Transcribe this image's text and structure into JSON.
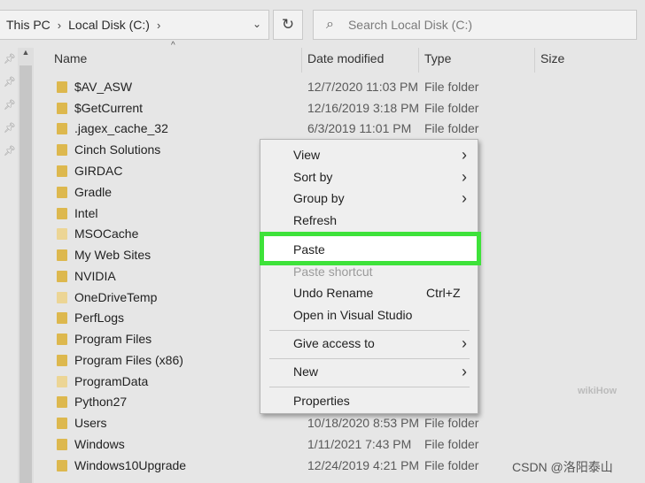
{
  "address": {
    "crumb1": "This PC",
    "crumb2": "Local Disk (C:)",
    "sep": "›",
    "dropdown": "⌄"
  },
  "refresh_glyph": "↻",
  "search": {
    "placeholder": "Search Local Disk (C:)",
    "icon": "search-icon"
  },
  "columns": {
    "name": "Name",
    "date": "Date modified",
    "type": "Type",
    "size": "Size"
  },
  "files": [
    {
      "name": "$AV_ASW",
      "date": "12/7/2020 11:03 PM",
      "type": "File folder",
      "faded": false
    },
    {
      "name": "$GetCurrent",
      "date": "12/16/2019 3:18 PM",
      "type": "File folder",
      "faded": false
    },
    {
      "name": ".jagex_cache_32",
      "date": "6/3/2019 11:01 PM",
      "type": "File folder",
      "faded": false
    },
    {
      "name": "Cinch Solutions",
      "date": "",
      "type": "",
      "faded": false
    },
    {
      "name": "GIRDAC",
      "date": "",
      "type": "",
      "faded": false
    },
    {
      "name": "Gradle",
      "date": "",
      "type": "",
      "faded": false
    },
    {
      "name": "Intel",
      "date": "",
      "type": "",
      "faded": false
    },
    {
      "name": "MSOCache",
      "date": "",
      "type": "",
      "faded": true
    },
    {
      "name": "My Web Sites",
      "date": "",
      "type": "",
      "faded": false
    },
    {
      "name": "NVIDIA",
      "date": "",
      "type": "",
      "faded": false
    },
    {
      "name": "OneDriveTemp",
      "date": "",
      "type": "",
      "faded": true
    },
    {
      "name": "PerfLogs",
      "date": "",
      "type": "",
      "faded": false
    },
    {
      "name": "Program Files",
      "date": "",
      "type": "",
      "faded": false
    },
    {
      "name": "Program Files (x86)",
      "date": "",
      "type": "",
      "faded": false
    },
    {
      "name": "ProgramData",
      "date": "",
      "type": "",
      "faded": true
    },
    {
      "name": "Python27",
      "date": "",
      "type": "",
      "faded": false
    },
    {
      "name": "Users",
      "date": "10/18/2020 8:53 PM",
      "type": "File folder",
      "faded": false
    },
    {
      "name": "Windows",
      "date": "1/11/2021 7:43 PM",
      "type": "File folder",
      "faded": false
    },
    {
      "name": "Windows10Upgrade",
      "date": "12/24/2019 4:21 PM",
      "type": "File folder",
      "faded": false
    }
  ],
  "context_menu": {
    "view": "View",
    "sort_by": "Sort by",
    "group_by": "Group by",
    "refresh": "Refresh",
    "paste": "Paste",
    "paste_shortcut": "Paste shortcut",
    "undo_rename": "Undo Rename",
    "undo_shortcut": "Ctrl+Z",
    "open_vs": "Open in Visual Studio",
    "give_access": "Give access to",
    "new": "New",
    "properties": "Properties",
    "arrow": "›"
  },
  "colors": {
    "highlight": "#3ee23a",
    "folder": "#ddb84e"
  },
  "watermark": {
    "csdn": "CSDN @洛阳泰山",
    "wikihow": "wikiHow"
  }
}
